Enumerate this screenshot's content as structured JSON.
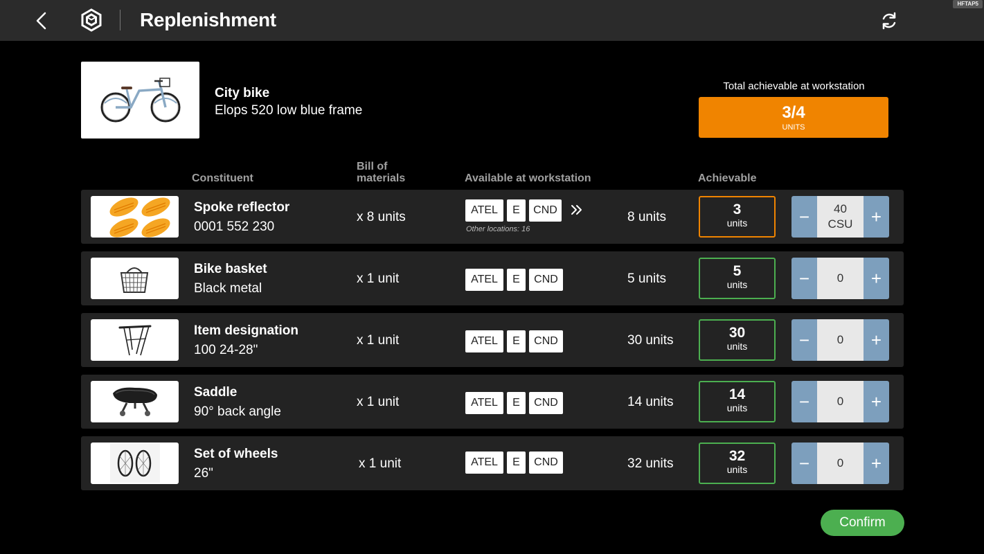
{
  "header": {
    "title": "Replenishment",
    "device_tag": "HFTAP5"
  },
  "product": {
    "name": "City bike",
    "description": "Elops 520 low blue frame"
  },
  "total": {
    "label": "Total achievable at workstation",
    "value": "3/4",
    "unit": "UNITS",
    "color": "#f08400"
  },
  "columns": {
    "constituent": "Constituent",
    "bom_line1": "Bill of",
    "bom_line2": "materials",
    "available": "Available at workstation",
    "achievable": "Achievable"
  },
  "rows": [
    {
      "name": "Spoke reflector",
      "ref": "0001 552 230",
      "bom": "x 8 units",
      "loc": [
        "ATEL",
        "E",
        "CND"
      ],
      "other": "Other locations: 16",
      "available": "8 units",
      "achievable": "3",
      "achievable_unit": "units",
      "qty": "40",
      "qty_unit": "CSU",
      "icon": "reflector-icon"
    },
    {
      "name": "Bike basket",
      "ref": "Black metal",
      "bom": "x 1 unit",
      "loc": [
        "ATEL",
        "E",
        "CND"
      ],
      "available": "5 units",
      "achievable": "5",
      "achievable_unit": "units",
      "qty": "0",
      "icon": "basket-icon"
    },
    {
      "name": "Item designation",
      "ref": "100 24-28\"",
      "bom": "x 1 unit",
      "loc": [
        "ATEL",
        "E",
        "CND"
      ],
      "available": "30 units",
      "achievable": "30",
      "achievable_unit": "units",
      "qty": "0",
      "icon": "rack-icon"
    },
    {
      "name": "Saddle",
      "ref": "90° back angle",
      "bom": "x 1 unit",
      "loc": [
        "ATEL",
        "E",
        "CND"
      ],
      "available": "14 units",
      "achievable": "14",
      "achievable_unit": "units",
      "qty": "0",
      "icon": "saddle-icon"
    },
    {
      "name": "Set of wheels",
      "ref": "26\"",
      "bom": "x 1 unit",
      "loc": [
        "ATEL",
        "E",
        "CND"
      ],
      "available": "32 units",
      "achievable": "32",
      "achievable_unit": "units",
      "qty": "0",
      "icon": "wheels-icon"
    }
  ],
  "stepper": {
    "minus": "−",
    "plus": "+"
  },
  "confirm": "Confirm",
  "colors": {
    "ok": "#4caf50",
    "warn": "#f08400",
    "stepper": "#7d9fbd"
  }
}
